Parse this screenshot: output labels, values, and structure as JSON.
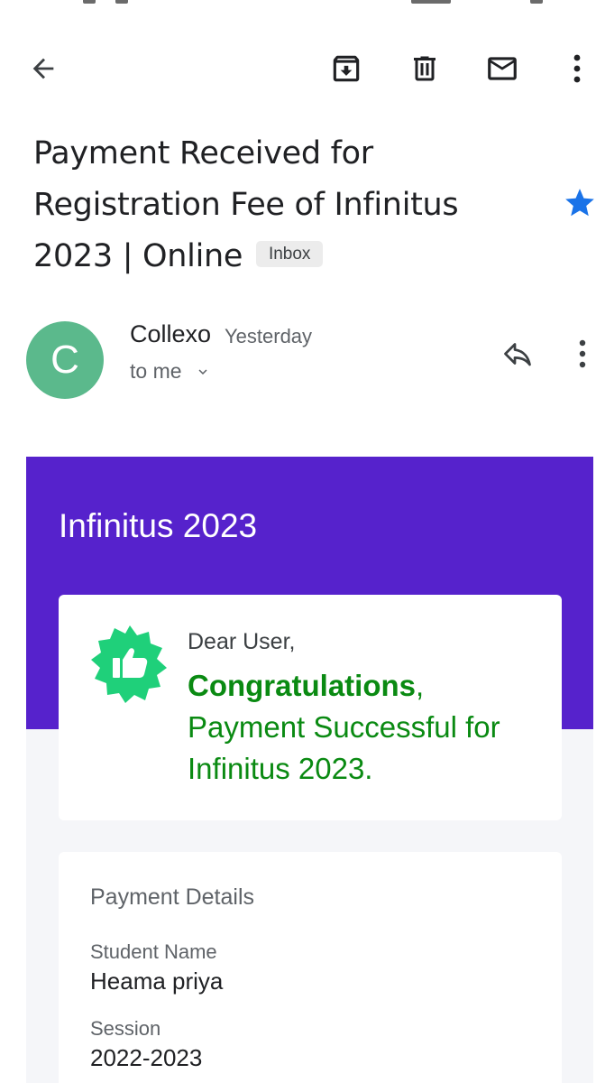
{
  "email": {
    "subject": "Payment Received for Registration Fee of Infinitus 2023 | Online",
    "label": "Inbox",
    "starred": true,
    "sender": {
      "avatar_letter": "C",
      "name": "Collexo",
      "time": "Yesterday",
      "recipient": "to me"
    }
  },
  "toolbar": {
    "icons": [
      "back-arrow-icon",
      "archive-icon",
      "delete-icon",
      "mark-unread-icon",
      "more-vert-icon"
    ]
  },
  "body": {
    "brand": "Infinitus 2023",
    "greeting": "Dear User,",
    "congrats_word": "Congratulations",
    "congrats_punct": ",",
    "payment_message": "Payment Successful for Infinitus 2023.",
    "details": {
      "title": "Payment Details",
      "fields": [
        {
          "label": "Student Name",
          "value": "Heama priya"
        },
        {
          "label": "Session",
          "value": "2022-2023"
        }
      ]
    }
  },
  "colors": {
    "header_purple": "#5622cc",
    "success_green": "#0a8a12",
    "badge_green": "#1fd07a",
    "avatar_green": "#5bb98c",
    "star_blue": "#1a73e8"
  }
}
